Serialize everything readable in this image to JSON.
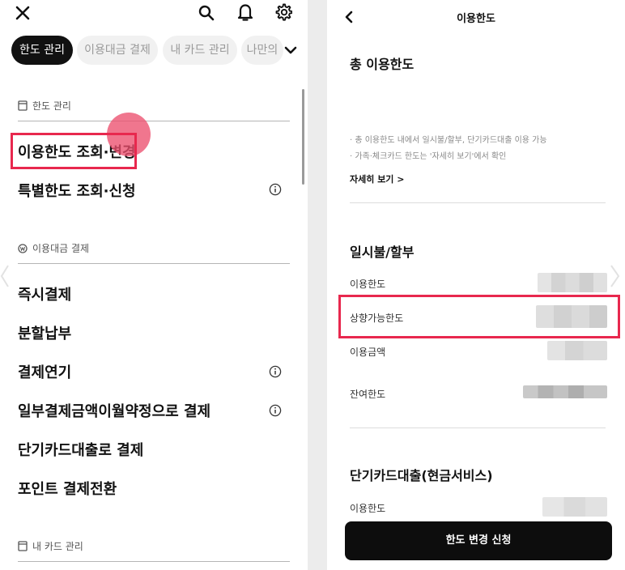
{
  "left": {
    "chips": [
      {
        "label": "한도 관리"
      },
      {
        "label": "이용대금 결제"
      },
      {
        "label": "내 카드 관리"
      },
      {
        "label": "나만의"
      }
    ],
    "sections": [
      {
        "title": "한도 관리",
        "icon": "document-icon",
        "items": [
          "이용한도 조회·변경",
          "특별한도 조회·신청"
        ]
      },
      {
        "title": "이용대금 결제",
        "icon": "won-icon",
        "items": [
          "즉시결제",
          "분할납부",
          "결제연기",
          "일부결제금액이월약정으로 결제",
          "단기카드대출로 결제",
          "포인트 결제전환"
        ]
      },
      {
        "title": "내 카드 관리",
        "icon": "card-icon",
        "items": []
      }
    ],
    "info_icons_on": [
      "특별한도 조회·신청",
      "결제연기",
      "일부결제금액이월약정으로 결제"
    ],
    "highlight_color": "#e8284e"
  },
  "right": {
    "title": "이용한도",
    "total": {
      "heading": "총 이용한도",
      "notes": [
        "· 총 이용한도 내에서 일시불/할부, 단기카드대출 이용 가능",
        "· 가족·체크카드 한도는 '자세히 보기'에서 확인"
      ],
      "link": "자세히 보기 >"
    },
    "installment": {
      "heading": "일시불/할부",
      "rows": [
        "이용한도",
        "상향가능한도",
        "이용금액",
        "잔여한도"
      ]
    },
    "cash_service": {
      "heading": "단기카드대출(현금서비스)",
      "rows": [
        "이용한도"
      ]
    },
    "button": "한도 변경 신청"
  }
}
